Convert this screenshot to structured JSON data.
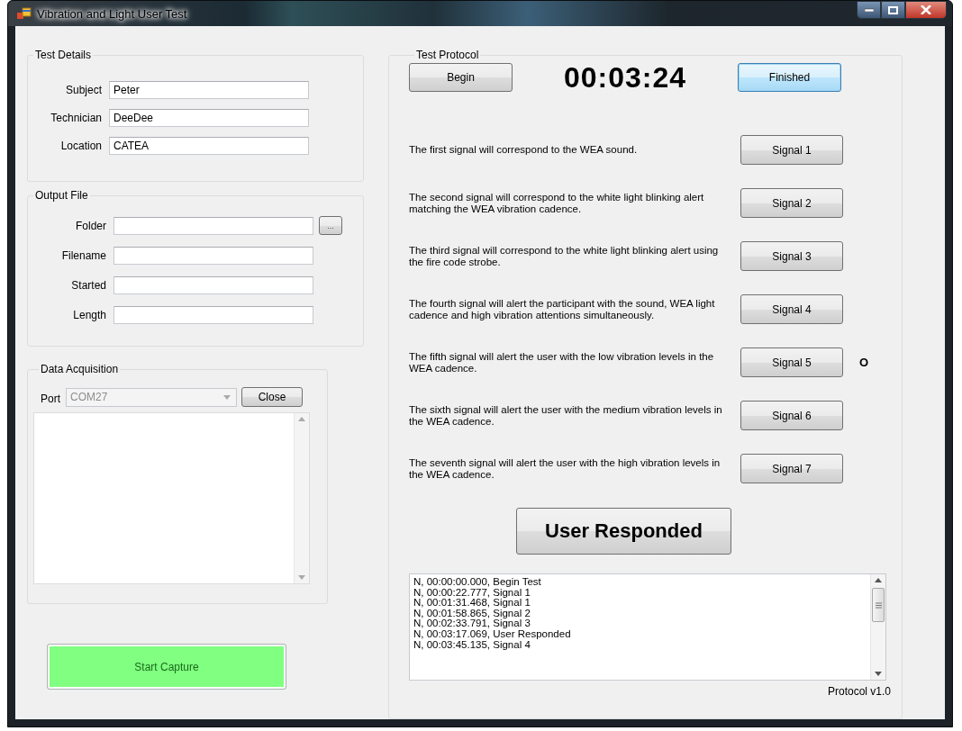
{
  "window": {
    "title": "Vibration and Light User Test"
  },
  "test_details": {
    "title": "Test Details",
    "fields": [
      {
        "label": "Subject",
        "value": "Peter"
      },
      {
        "label": "Technician",
        "value": "DeeDee"
      },
      {
        "label": "Location",
        "value": "CATEA"
      }
    ]
  },
  "output_file": {
    "title": "Output File",
    "browse_button": "...",
    "fields": [
      {
        "label": "Folder",
        "kind": "browse"
      },
      {
        "label": "Filename",
        "kind": "plain"
      },
      {
        "label": "Started",
        "kind": "plain"
      },
      {
        "label": "Length",
        "kind": "plain"
      }
    ]
  },
  "data_acquisition": {
    "title": "Data Acquisition",
    "port": {
      "label": "Port",
      "value": "COM27",
      "disabled": true
    },
    "close_button": "Close"
  },
  "start_capture_button": "Start Capture",
  "test_protocol": {
    "title": "Test Protocol",
    "begin_button": {
      "label": "Begin",
      "focused": false
    },
    "timer": "00:03:24",
    "finished_button": {
      "label": "Finished",
      "focused": true
    },
    "signals": [
      {
        "description": "The first signal will correspond to the WEA sound.",
        "button": "Signal 1"
      },
      {
        "description": "The second signal will correspond to the white light blinking alert matching the WEA vibration cadence.",
        "button": "Signal 2"
      },
      {
        "description": "The third signal will correspond to the white light blinking alert using the fire code strobe.",
        "button": "Signal 3"
      },
      {
        "description": "The fourth signal will alert the participant with the sound, WEA light cadence and high vibration attentions simultaneously.",
        "button": "Signal 4"
      },
      {
        "description": "The fifth signal will alert the user with the low vibration levels in the WEA cadence.",
        "button": "Signal 5",
        "indicator": "O"
      },
      {
        "description": "The sixth signal will alert the user with the medium vibration levels in the WEA cadence.",
        "button": "Signal 6"
      },
      {
        "description": "The seventh signal will alert the user with the high vibration levels in the WEA cadence.",
        "button": "Signal 7"
      }
    ],
    "user_responded_button": "User Responded",
    "log": [
      "N, 00:00:00.000, Begin Test",
      "N, 00:00:22.777, Signal 1",
      "N, 00:01:31.468, Signal 1",
      "N, 00:01:58.865, Signal 2",
      "N, 00:02:33.791, Signal 3",
      "N, 00:03:17.069, User Responded",
      "N, 00:03:45.135, Signal 4"
    ],
    "version": "Protocol v1.0"
  }
}
